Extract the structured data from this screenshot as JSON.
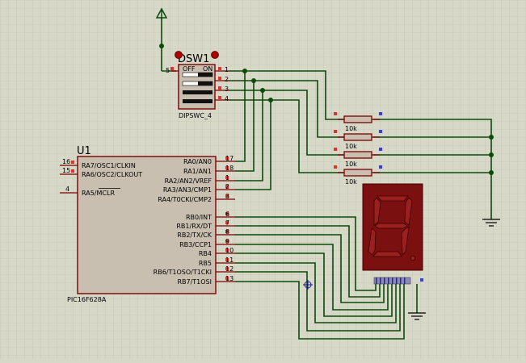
{
  "dipswitch": {
    "ref": "DSW1",
    "part": "DIPSWC_4",
    "off_label": "OFF",
    "on_label": "ON",
    "common_pin": "5",
    "pins": [
      "1",
      "2",
      "3",
      "4"
    ]
  },
  "mcu": {
    "ref": "U1",
    "part": "PIC16F628A",
    "left_pins": [
      {
        "num": "16",
        "name": "RA7/OSC1/CLKIN"
      },
      {
        "num": "15",
        "name": "RA6/OSC2/CLKOUT"
      },
      {
        "num": "4",
        "name": "RA5/MCLR"
      }
    ],
    "right_pins": [
      {
        "num": "17",
        "name": "RA0/AN0"
      },
      {
        "num": "18",
        "name": "RA1/AN1"
      },
      {
        "num": "1",
        "name": "RA2/AN2/VREF"
      },
      {
        "num": "2",
        "name": "RA3/AN3/CMP1"
      },
      {
        "num": "3",
        "name": "RA4/T0CKI/CMP2"
      },
      {
        "num": "6",
        "name": "RB0/INT"
      },
      {
        "num": "7",
        "name": "RB1/RX/DT"
      },
      {
        "num": "8",
        "name": "RB2/TX/CK"
      },
      {
        "num": "9",
        "name": "RB3/CCP1"
      },
      {
        "num": "10",
        "name": "RB4"
      },
      {
        "num": "11",
        "name": "RB5"
      },
      {
        "num": "12",
        "name": "RB6/T1OSO/T1CKI"
      },
      {
        "num": "13",
        "name": "RB7/T1OSI"
      }
    ]
  },
  "resistors": [
    {
      "value": "10k"
    },
    {
      "value": "10k"
    },
    {
      "value": "10k"
    },
    {
      "value": "10k"
    }
  ],
  "display": {
    "digit": "8"
  },
  "colors": {
    "background": "#d8d8c8",
    "wire": "#0a4a0a",
    "component": "#7a0000",
    "display_body": "#7a1010"
  }
}
